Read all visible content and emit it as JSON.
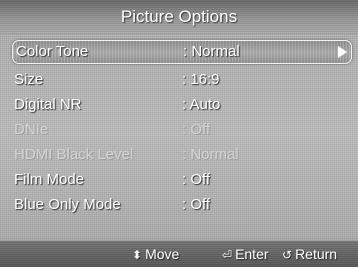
{
  "title": "Picture Options",
  "menu": {
    "items": [
      {
        "label": "Color Tone",
        "value": ": Normal",
        "state": "selected"
      },
      {
        "label": "Size",
        "value": ": 16:9",
        "state": "normal"
      },
      {
        "label": "Digital NR",
        "value": ": Auto",
        "state": "normal"
      },
      {
        "label": "DNIe",
        "value": ": Off",
        "state": "disabled"
      },
      {
        "label": "HDMI Black Level",
        "value": ": Normal",
        "state": "disabled"
      },
      {
        "label": "Film Mode",
        "value": ": Off",
        "state": "normal"
      },
      {
        "label": "Blue Only Mode",
        "value": ": Off",
        "state": "normal"
      }
    ],
    "selected_arrow_icon": "right-arrow-icon"
  },
  "footer": {
    "move": {
      "icon": "updown-arrow-icon",
      "glyph": "⬍",
      "label": "Move"
    },
    "enter": {
      "icon": "enter-icon",
      "glyph": "⏎",
      "label": "Enter"
    },
    "return": {
      "icon": "return-icon",
      "glyph": "↺",
      "label": "Return"
    }
  }
}
